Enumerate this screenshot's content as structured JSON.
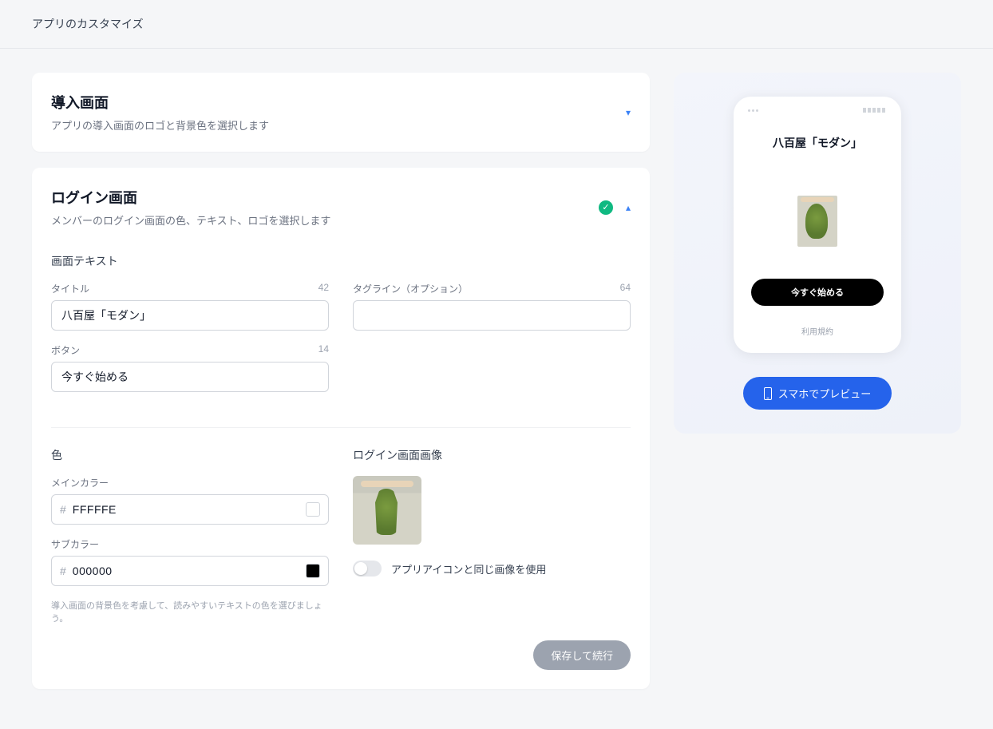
{
  "header": {
    "title": "アプリのカスタマイズ"
  },
  "intro_card": {
    "title": "導入画面",
    "subtitle": "アプリの導入画面のロゴと背景色を選択します"
  },
  "login_card": {
    "title": "ログイン画面",
    "subtitle": "メンバーのログイン画面の色、テキスト、ロゴを選択します",
    "sections": {
      "text": {
        "heading": "画面テキスト",
        "title_field": {
          "label": "タイトル",
          "value": "八百屋「モダン」",
          "count": "42"
        },
        "tagline_field": {
          "label": "タグライン（オプション）",
          "value": "",
          "count": "64"
        },
        "button_field": {
          "label": "ボタン",
          "value": "今すぐ始める",
          "count": "14"
        }
      },
      "color": {
        "heading": "色",
        "main": {
          "label": "メインカラー",
          "value": "FFFFFE",
          "hex": "#FFFFFE"
        },
        "sub": {
          "label": "サブカラー",
          "value": "000000",
          "hex": "#000000"
        },
        "helper": "導入画面の背景色を考慮して、読みやすいテキストの色を選びましょう。"
      },
      "image": {
        "heading": "ログイン画面画像",
        "toggle_label": "アプリアイコンと同じ画像を使用"
      }
    },
    "save_label": "保存して続行"
  },
  "preview": {
    "phone_title": "八百屋「モダン」",
    "cta": "今すぐ始める",
    "terms": "利用規約",
    "button": "スマホでプレビュー"
  }
}
